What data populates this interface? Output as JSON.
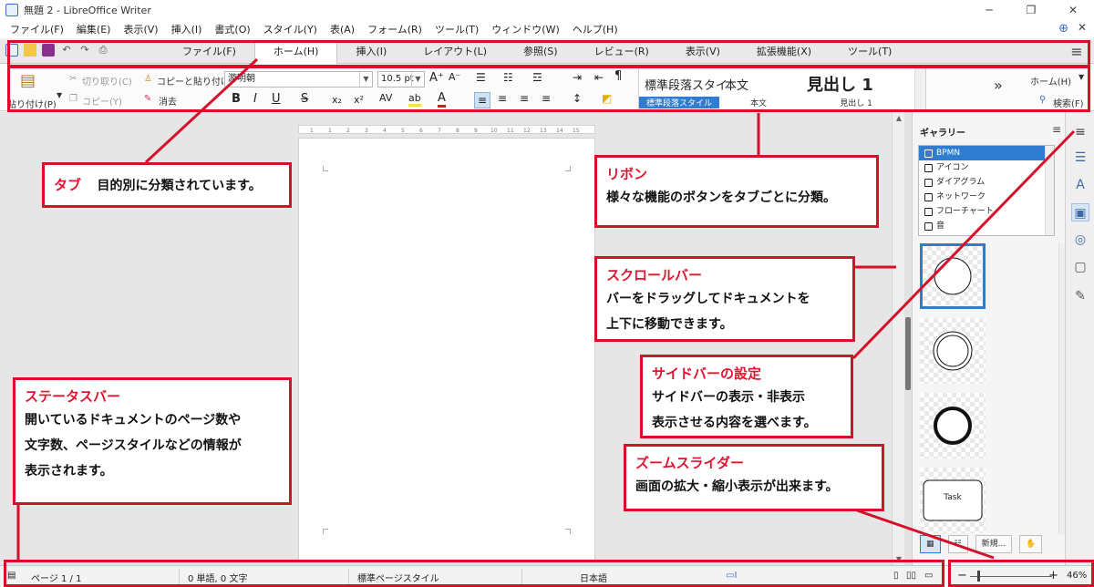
{
  "window": {
    "title": "無題 2 - LibreOffice Writer",
    "min": "─",
    "restore": "❐",
    "close": "✕"
  },
  "menubar": {
    "items": [
      "ファイル(F)",
      "編集(E)",
      "表示(V)",
      "挿入(I)",
      "書式(O)",
      "スタイル(Y)",
      "表(A)",
      "フォーム(R)",
      "ツール(T)",
      "ウィンドウ(W)",
      "ヘルプ(H)"
    ],
    "close": "✕"
  },
  "tabs": {
    "items": [
      "ファイル(F)",
      "ホーム(H)",
      "挿入(I)",
      "レイアウト(L)",
      "参照(S)",
      "レビュー(R)",
      "表示(V)",
      "拡張機能(X)",
      "ツール(T)"
    ],
    "active": 1
  },
  "ribbon": {
    "paste": "貼り付け(P)",
    "cut": "切り取り(C)",
    "copy": "コピー(Y)",
    "clone": "コピーと貼り付け",
    "clear": "消去",
    "font_name": "游明朝",
    "font_size": "10.5 pt",
    "bold": "B",
    "italic": "I",
    "underline": "U",
    "strike": "S",
    "sub": "x₂",
    "sup": "x²",
    "styles": [
      {
        "preview": "標準段落スタイ",
        "label": "標準段落スタイル"
      },
      {
        "preview": "本文",
        "label": "本文"
      },
      {
        "preview": "見出し 1",
        "label": "見出し 1"
      }
    ],
    "more": "»",
    "home_dropdown": "ホーム(H)",
    "search": "検索(F)"
  },
  "ruler": {
    "ticks": [
      "1",
      "1",
      "2",
      "3",
      "4",
      "5",
      "6",
      "7",
      "8",
      "9",
      "10",
      "11",
      "12",
      "13",
      "14",
      "15"
    ]
  },
  "gallery": {
    "title": "ギャラリー",
    "items": [
      "BPMN",
      "アイコン",
      "ダイアグラム",
      "ネットワーク",
      "フローチャート",
      "音"
    ],
    "selected": 0,
    "thumb_task": "Task",
    "buttons": [
      "新規..."
    ]
  },
  "statusbar": {
    "page": "ページ 1 / 1",
    "words": "0 単語, 0 文字",
    "page_style": "標準ページスタイル",
    "language": "日本語",
    "zoom_minus": "−",
    "zoom_plus": "+",
    "zoom": "46%"
  },
  "annotations": {
    "tab": {
      "title": "タブ",
      "body": "目的別に分類されています。"
    },
    "ribbon": {
      "title": "リボン",
      "body": "様々な機能のボタンをタブごとに分類。"
    },
    "scrollbar": {
      "title": "スクロールバー",
      "body1": "バーをドラッグしてドキュメントを",
      "body2": "上下に移動できます。"
    },
    "sidebar": {
      "title": "サイドバーの設定",
      "body1": "サイドバーの表示・非表示",
      "body2": "表示させる内容を選べます。"
    },
    "statusbar": {
      "title": "ステータスバー",
      "body1": "開いているドキュメントのページ数や",
      "body2": "文字数、ページスタイルなどの情報が",
      "body3": "表示されます。"
    },
    "zoom": {
      "title": "ズームスライダー",
      "body": "画面の拡大・縮小表示が出来ます。"
    }
  },
  "colors": {
    "annotation_red": "#d6102a",
    "accent_blue": "#2e7dd1"
  }
}
